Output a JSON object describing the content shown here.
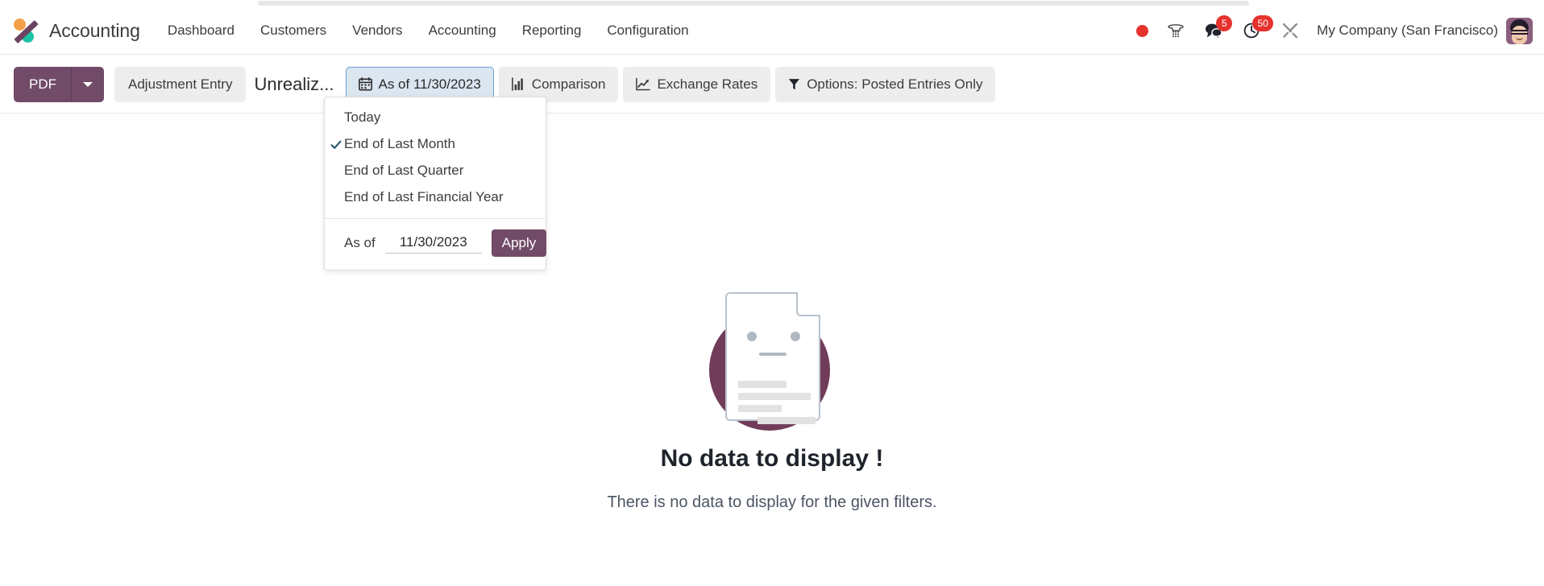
{
  "navbar": {
    "brand": "Accounting",
    "logo_colors": {
      "orange": "#f4a04a",
      "teal": "#1ec2a4",
      "slash": "#6c4360"
    },
    "menu": [
      {
        "label": "Dashboard"
      },
      {
        "label": "Customers"
      },
      {
        "label": "Vendors"
      },
      {
        "label": "Accounting"
      },
      {
        "label": "Reporting"
      },
      {
        "label": "Configuration"
      }
    ],
    "systray": {
      "recording_dot": "",
      "messages_badge": "5",
      "activities_badge": "50"
    },
    "company": "My Company (San Francisco)"
  },
  "toolbar": {
    "pdf_label": "PDF",
    "adjustment_entry_label": "Adjustment Entry",
    "report_name": "Unrealiz...",
    "date_filter_label": "As of 11/30/2023",
    "comparison_label": "Comparison",
    "exchange_rates_label": "Exchange Rates",
    "options_label": "Options: Posted Entries Only",
    "primary_color": "#714b67",
    "active_filter_bg": "#dbe6f1",
    "active_filter_border": "#6b9ed4"
  },
  "date_dropdown": {
    "options": [
      {
        "label": "Today",
        "selected": false
      },
      {
        "label": "End of Last Month",
        "selected": true
      },
      {
        "label": "End of Last Quarter",
        "selected": false
      },
      {
        "label": "End of Last Financial Year",
        "selected": false
      }
    ],
    "as_of_label": "As of",
    "as_of_value": "11/30/2023",
    "as_of_placeholder": "MM/DD/YYYY",
    "apply_label": "Apply"
  },
  "empty_state": {
    "title": "No data to display !",
    "subtitle": "There is no data to display for the given filters."
  }
}
